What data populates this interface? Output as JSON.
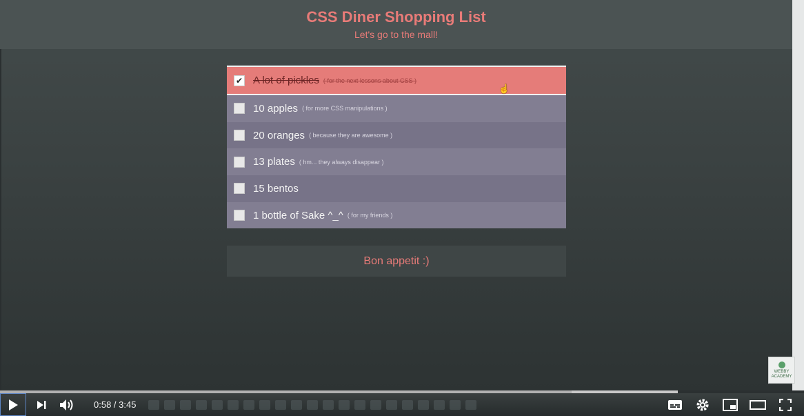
{
  "page": {
    "title": "CSS Diner Shopping List",
    "subtitle": "Let's go to the mall!",
    "footer_label": "Bon appetit :)"
  },
  "items": [
    {
      "label": "A lot of pickles",
      "note": "( for the next lessons about CSS )",
      "checked": true
    },
    {
      "label": "10 apples",
      "note": "( for more CSS manipulations )",
      "checked": false
    },
    {
      "label": "20 oranges",
      "note": "( because they are awesome )",
      "checked": false
    },
    {
      "label": "13 plates",
      "note": "( hm... they always disappear )",
      "checked": false
    },
    {
      "label": "15 bentos",
      "note": "",
      "checked": false
    },
    {
      "label": "1 bottle of Sake ^_^",
      "note": "( for my friends )",
      "checked": false
    }
  ],
  "player": {
    "time_display": "0:58 / 3:45",
    "played_fraction": 0.2575,
    "buffered_fraction": 0.843,
    "icons": [
      "play-icon",
      "next-icon",
      "volume-icon",
      "subtitles-icon",
      "settings-icon",
      "miniplayer-icon",
      "theater-icon",
      "fullscreen-icon"
    ]
  },
  "watermark": {
    "line1": "WEBBY",
    "line2": "ACADEMY"
  },
  "colors": {
    "accent": "#e87b78",
    "progress": "#ff0000",
    "row_odd": "#777388",
    "row_even": "#827e92",
    "row_done": "#e57c79"
  }
}
